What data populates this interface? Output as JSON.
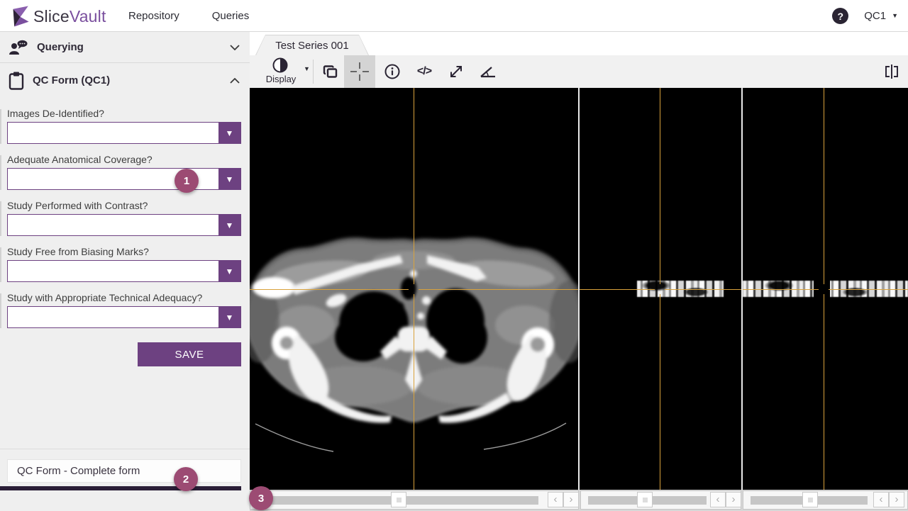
{
  "header": {
    "brand": {
      "part1": "Slice",
      "part2": "Vault"
    },
    "nav": [
      {
        "label": "Repository"
      },
      {
        "label": "Queries"
      }
    ],
    "user_label": "QC1"
  },
  "sidebar": {
    "sections": [
      {
        "label": "Querying",
        "state": "collapsed"
      },
      {
        "label": "QC Form (QC1)",
        "state": "expanded"
      }
    ],
    "form": {
      "fields": [
        {
          "label": "Images De-Identified?",
          "value": ""
        },
        {
          "label": "Adequate Anatomical Coverage?",
          "value": ""
        },
        {
          "label": "Study Performed with Contrast?",
          "value": ""
        },
        {
          "label": "Study Free from Biasing Marks?",
          "value": ""
        },
        {
          "label": "Study with Appropriate Technical Adequacy?",
          "value": ""
        }
      ],
      "save_label": "SAVE"
    },
    "footer_message": "QC Form - Complete form"
  },
  "main": {
    "tab_label": "Test Series 001",
    "toolbar": {
      "display_label": "Display",
      "code_glyph": "</>"
    }
  },
  "annotations": [
    {
      "number": "1"
    },
    {
      "number": "2"
    },
    {
      "number": "3"
    }
  ],
  "icons": {
    "help_glyph": "?",
    "dropdown_glyph": "▼",
    "caret_glyph": "▼",
    "prev_glyph": "‹",
    "next_glyph": "›"
  },
  "colors": {
    "brand": "#6d4181",
    "badge": "#9c4b73",
    "cross": "#d9a23c",
    "darkbar": "#2a1e37",
    "ink": "#2a2433"
  }
}
